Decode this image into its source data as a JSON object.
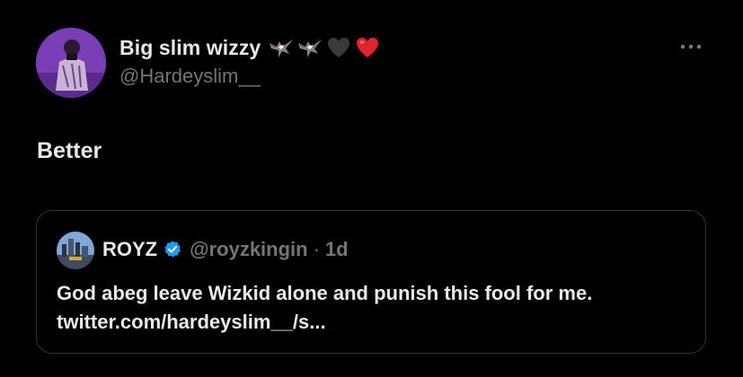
{
  "tweet": {
    "display_name": "Big slim wizzy",
    "name_emojis": [
      "eagle-icon",
      "eagle-icon",
      "black-heart-icon",
      "red-heart-icon"
    ],
    "handle": "@Hardeyslim__",
    "text": "Better"
  },
  "quoted_tweet": {
    "display_name": "ROYZ",
    "handle": "@royzkingin",
    "separator": "·",
    "time": "1d",
    "text": "God abeg leave Wizkid alone and punish this fool for me. twitter.com/hardeyslim__/s..."
  },
  "colors": {
    "background": "#000000",
    "primary_text": "#e7e9ea",
    "secondary_text": "#71767b",
    "verified_blue": "#1d9bf0",
    "border": "#2f3336",
    "avatar_purple": "#7b3fb8"
  }
}
